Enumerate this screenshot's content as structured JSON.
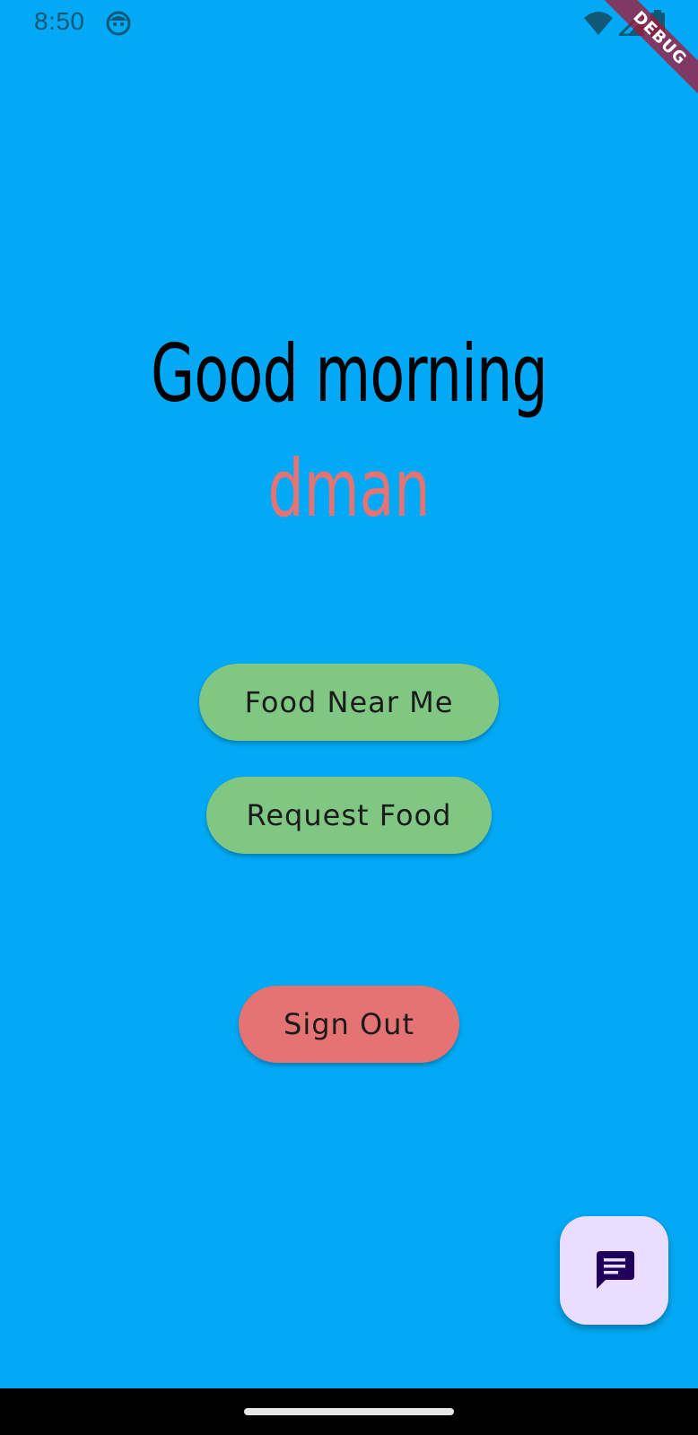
{
  "status_bar": {
    "time": "8:50",
    "icons": [
      "app-notification-icon",
      "wifi-icon",
      "cell-signal-icon",
      "battery-icon"
    ]
  },
  "debug_banner": {
    "label": "DEBUG"
  },
  "greeting": {
    "line1": "Good morning",
    "name": "dman"
  },
  "buttons": {
    "food_near_me": "Food Near Me",
    "request_food": "Request Food",
    "sign_out": "Sign Out"
  },
  "fab": {
    "icon": "chat-icon"
  },
  "colors": {
    "background": "#03a9f4",
    "green_button": "#81c784",
    "red_button": "#e57373",
    "username": "#e57373",
    "fab_background": "#eaddff",
    "fab_icon": "#21005d"
  }
}
